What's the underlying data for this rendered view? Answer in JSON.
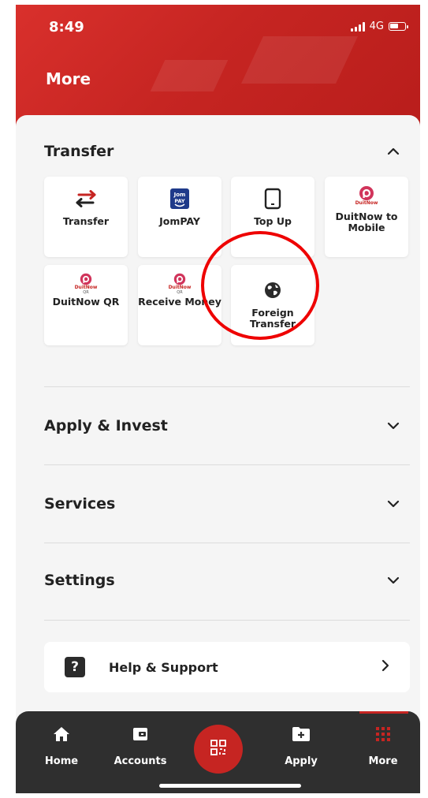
{
  "status": {
    "time": "8:49",
    "network": "4G"
  },
  "header": {
    "title": "More"
  },
  "transfer": {
    "title": "Transfer",
    "tiles": [
      {
        "label": "Transfer",
        "icon": "transfer-arrows-icon"
      },
      {
        "label": "JomPAY",
        "icon": "jompay-icon",
        "badge": "Jom PAY"
      },
      {
        "label": "Top Up",
        "icon": "phone-device-icon"
      },
      {
        "label": "DuitNow to Mobile",
        "icon": "duitnow-icon",
        "badge": "DuitNow"
      },
      {
        "label": "DuitNow QR",
        "icon": "duitnow-qr-icon",
        "badge": "DuitNow",
        "sub": "QR"
      },
      {
        "label": "Receive Money",
        "icon": "duitnow-qr-icon",
        "badge": "DuitNow",
        "sub": "QR"
      },
      {
        "label": "Foreign Transfer",
        "icon": "globe-icon"
      }
    ]
  },
  "sections": [
    {
      "title": "Apply & Invest"
    },
    {
      "title": "Services"
    },
    {
      "title": "Settings"
    }
  ],
  "help": {
    "label": "Help & Support"
  },
  "tabbar": {
    "tabs": [
      {
        "label": "Home",
        "icon": "home-icon"
      },
      {
        "label": "Accounts",
        "icon": "wallet-icon"
      },
      {
        "label": "Apply",
        "icon": "folder-plus-icon"
      },
      {
        "label": "More",
        "icon": "grid-icon"
      }
    ],
    "active": "More"
  },
  "colors": {
    "brand": "#c62522",
    "tabbar": "#2f2f2f",
    "background": "#f5f5f5",
    "annotation": "#ee0000"
  }
}
